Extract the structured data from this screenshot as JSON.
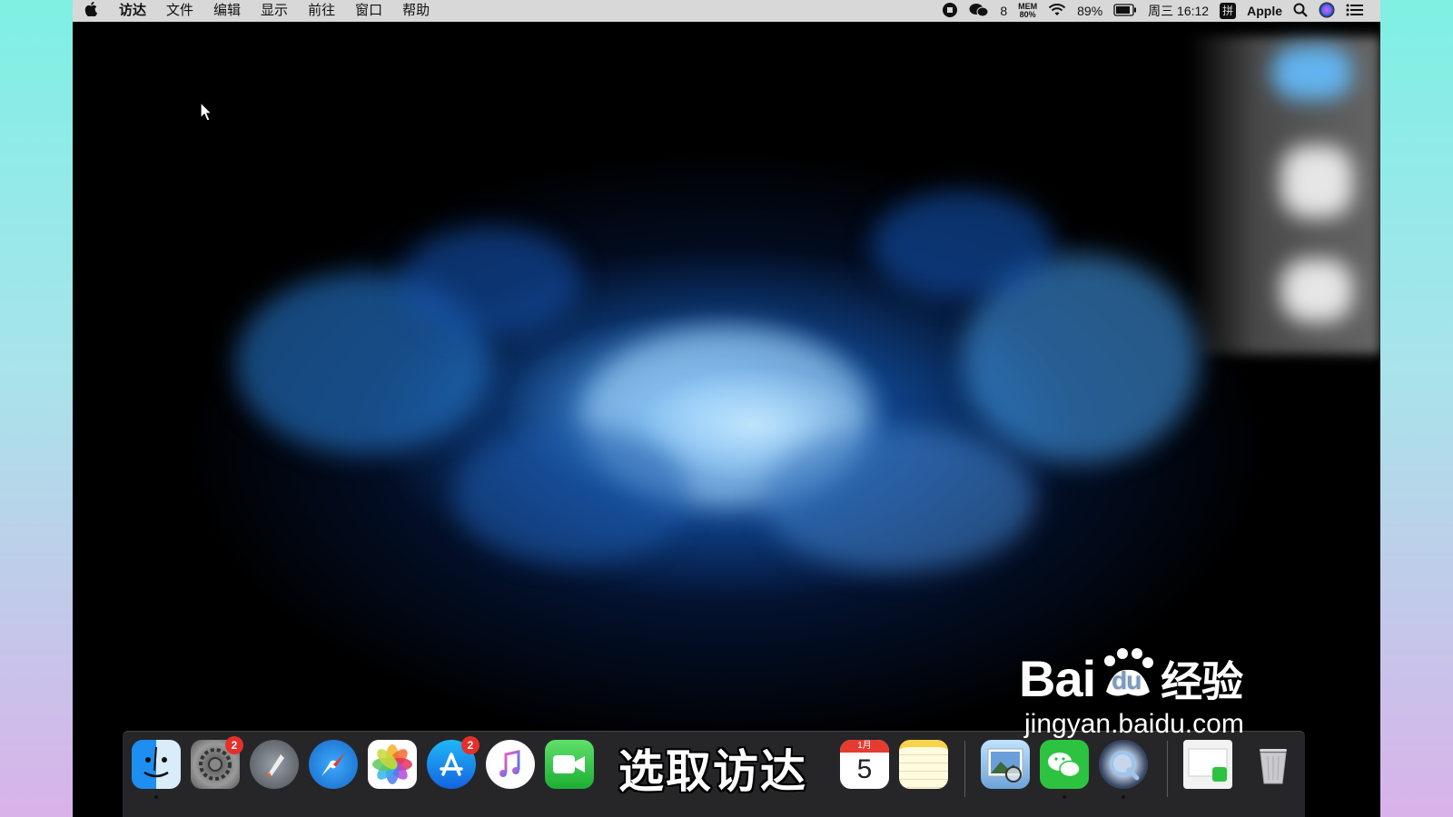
{
  "menubar": {
    "app_name": "访达",
    "items": [
      "文件",
      "编辑",
      "显示",
      "前往",
      "窗口",
      "帮助"
    ],
    "status": {
      "wechat_count": "8",
      "mem_label": "MEM",
      "mem_value": "80%",
      "battery": "89%",
      "datetime": "周三 16:12",
      "input_method": "拼",
      "user": "Apple"
    }
  },
  "dock": {
    "apps": [
      {
        "name": "finder-icon",
        "label": "访达"
      },
      {
        "name": "system-preferences-icon",
        "label": "系统偏好设置",
        "badge": "2"
      },
      {
        "name": "launchpad-icon",
        "label": "启动台"
      },
      {
        "name": "safari-icon",
        "label": "Safari"
      },
      {
        "name": "photos-icon",
        "label": "照片"
      },
      {
        "name": "app-store-icon",
        "label": "App Store",
        "badge": "2"
      },
      {
        "name": "itunes-icon",
        "label": "iTunes"
      },
      {
        "name": "facetime-icon",
        "label": "FaceTime"
      },
      {
        "name": "calendar-icon",
        "label": "日历",
        "month": "1月",
        "day": "5"
      },
      {
        "name": "notes-icon",
        "label": "备忘录"
      },
      {
        "name": "preview-icon",
        "label": "预览"
      },
      {
        "name": "wechat-icon",
        "label": "微信"
      },
      {
        "name": "quicktime-icon",
        "label": "QuickTime"
      },
      {
        "name": "trash-icon",
        "label": "废纸篓"
      }
    ]
  },
  "subtitle": "选取访达",
  "watermark": {
    "main": "Bai经验",
    "main_prefix": "Bai",
    "main_paw": "du",
    "main_suffix": "经验",
    "sub": "jingyan.baidu.com"
  }
}
